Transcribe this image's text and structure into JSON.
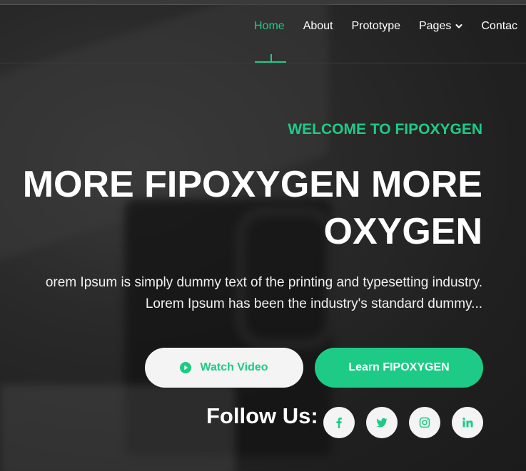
{
  "nav": {
    "items": [
      {
        "label": "Home",
        "active": true
      },
      {
        "label": "About"
      },
      {
        "label": "Prototype"
      },
      {
        "label": "Pages",
        "has_dropdown": true
      },
      {
        "label": "Contac"
      }
    ]
  },
  "hero": {
    "eyebrow": "WELCOME TO FIPOXYGEN",
    "title": "MORE FIPOXYGEN MORE OXYGEN",
    "description_line1": "orem Ipsum is simply dummy text of the printing and typesetting industry.",
    "description_line2": "Lorem Ipsum has been the industry's standard dummy..."
  },
  "buttons": {
    "watch_video": "Watch Video",
    "learn": "Learn FIPOXYGEN"
  },
  "follow": {
    "label": "Follow Us:",
    "socials": [
      "facebook-icon",
      "twitter-icon",
      "instagram-icon",
      "linkedin-icon"
    ]
  },
  "colors": {
    "accent": "#1ecb86",
    "background": "#1f1f1f",
    "button_light": "#f4f4f4"
  }
}
